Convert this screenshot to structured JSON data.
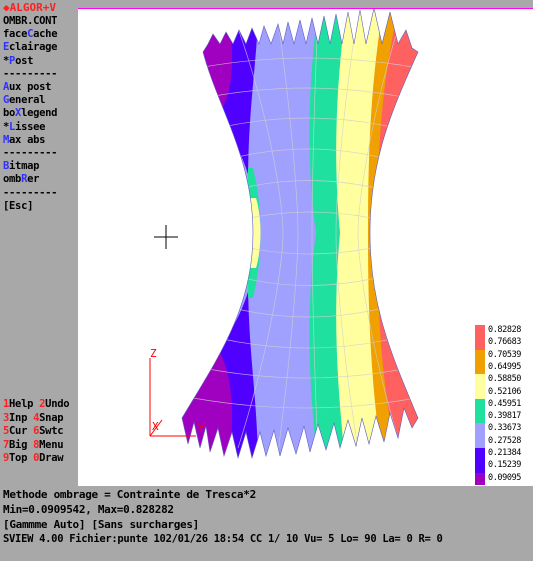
{
  "app_title": "ALGOR+V",
  "menu": {
    "items": [
      {
        "pre": "",
        "key": "",
        "post": "OMBR.CONT"
      },
      {
        "pre": "face",
        "key": "C",
        "post": "ache"
      },
      {
        "pre": "",
        "key": "E",
        "post": "clairage"
      },
      {
        "pre": "*",
        "key": "P",
        "post": "ost"
      },
      {
        "pre": "---------",
        "key": "",
        "post": ""
      },
      {
        "pre": "",
        "key": "A",
        "post": "ux post"
      },
      {
        "pre": "",
        "key": "G",
        "post": "eneral"
      },
      {
        "pre": "bo",
        "key": "X",
        "post": "legend"
      },
      {
        "pre": "*",
        "key": "L",
        "post": "issee"
      },
      {
        "pre": "",
        "key": "M",
        "post": "ax abs"
      },
      {
        "pre": "---------",
        "key": "",
        "post": ""
      },
      {
        "pre": "",
        "key": "B",
        "post": "itmap"
      },
      {
        "pre": "omb",
        "key": "R",
        "post": "er"
      },
      {
        "pre": "---------",
        "key": "",
        "post": ""
      },
      {
        "pre": "[Esc]",
        "key": "",
        "post": ""
      }
    ],
    "fkeys": [
      [
        {
          "n": "1",
          "t": "Help "
        },
        {
          "n": "2",
          "t": "Undo"
        }
      ],
      [
        {
          "n": "3",
          "t": "Inp "
        },
        {
          "n": "4",
          "t": "Snap"
        }
      ],
      [
        {
          "n": "5",
          "t": "Cur "
        },
        {
          "n": "6",
          "t": "Swtc"
        }
      ],
      [
        {
          "n": "7",
          "t": "Big "
        },
        {
          "n": "8",
          "t": "Menu"
        }
      ],
      [
        {
          "n": "9",
          "t": "Top "
        },
        {
          "n": "0",
          "t": "Draw"
        }
      ]
    ]
  },
  "axes": {
    "z": "Z",
    "x": "X",
    "y": "Y"
  },
  "legend": {
    "values": [
      "0.82828",
      "0.76683",
      "0.70539",
      "0.64995",
      "0.58850",
      "0.52106",
      "0.45951",
      "0.39817",
      "0.33673",
      "0.27528",
      "0.21384",
      "0.15239",
      "0.09095"
    ],
    "colors": [
      "#ff6060",
      "#ff6060",
      "#f0a000",
      "#f0a000",
      "#ffffa0",
      "#ffffa0",
      "#20e0a0",
      "#20e0a0",
      "#a0a0ff",
      "#a0a0ff",
      "#5000ff",
      "#5000ff",
      "#a000c0"
    ]
  },
  "status": {
    "line1": "Methode ombrage = Contrainte de Tresca*2",
    "line2": "Min=0.0909542, Max=0.828282",
    "line3": "[Gammme Auto] [Sans surcharges]",
    "line4": "SVIEW 4.00 Fichier:punte 102/01/26 18:54 CC  1/ 10 Vu= 5 Lo=  90 La=   0 R=   0"
  }
}
